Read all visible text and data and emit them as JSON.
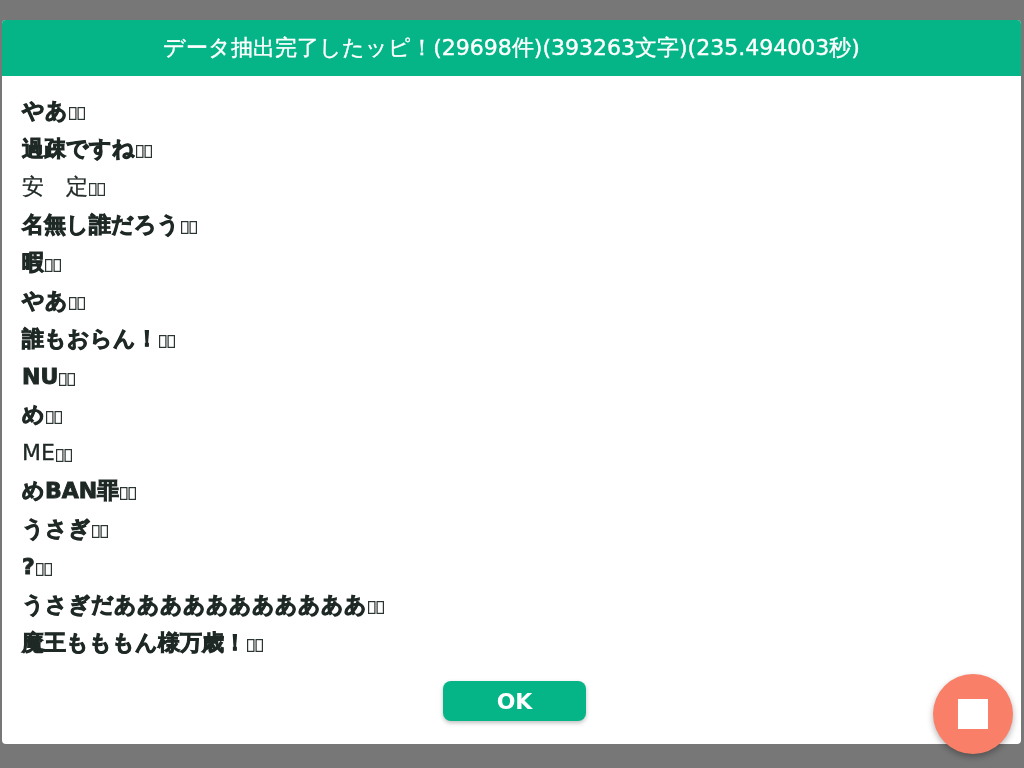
{
  "dialog": {
    "title": "データ抽出完了したッピ！(29698件)(393263文字)(235.494003秒)",
    "lines": [
      {
        "text": "やあ",
        "bold": true
      },
      {
        "text": "過疎ですね",
        "bold": true
      },
      {
        "text": "安　定",
        "bold": false
      },
      {
        "text": "名無し誰だろう",
        "bold": true
      },
      {
        "text": "暇",
        "bold": true
      },
      {
        "text": "やあ",
        "bold": true
      },
      {
        "text": "誰もおらん！",
        "bold": true
      },
      {
        "text": "NU",
        "bold": true
      },
      {
        "text": "め",
        "bold": true
      },
      {
        "text": "ME",
        "bold": false
      },
      {
        "text": "めBAN罪",
        "bold": true
      },
      {
        "text": "うさぎ",
        "bold": true
      },
      {
        "text": "?",
        "bold": true
      },
      {
        "text": "うさぎだあああああああああああ",
        "bold": true
      },
      {
        "text": "魔王もももん様万歳！",
        "bold": true
      }
    ],
    "button": "OK"
  }
}
